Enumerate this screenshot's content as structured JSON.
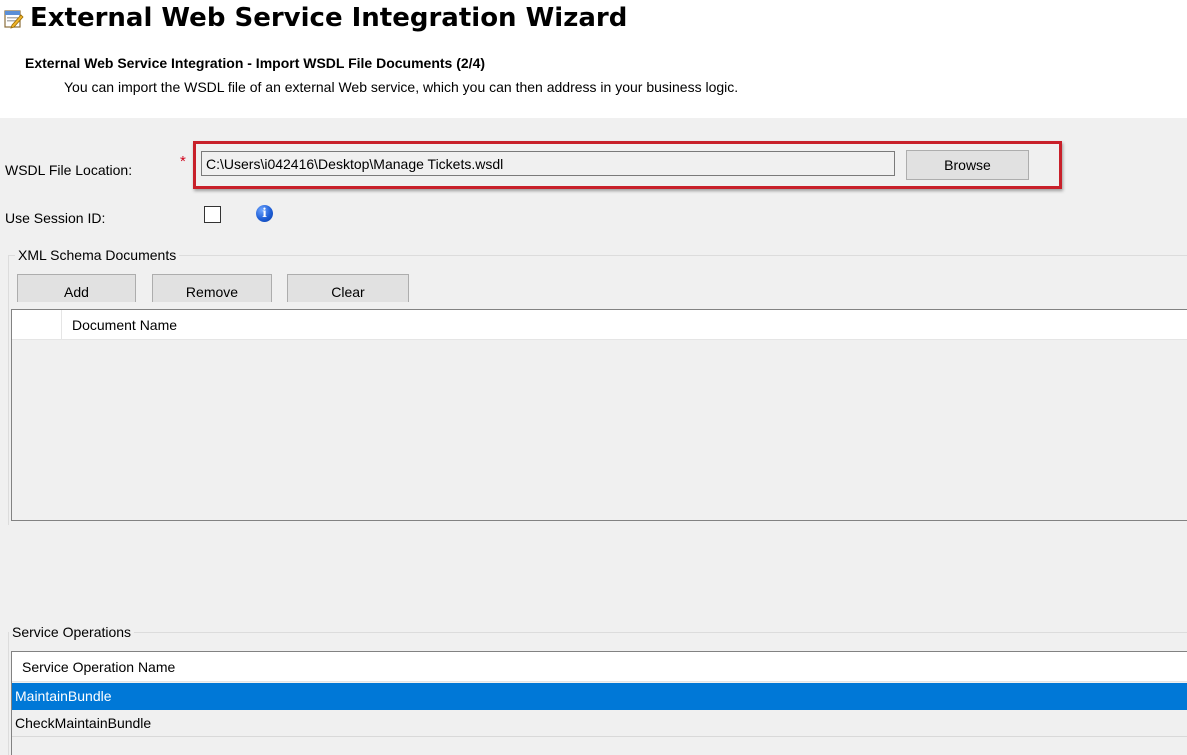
{
  "wizard": {
    "title": "External Web Service Integration Wizard",
    "step_title": "External Web Service Integration - Import WSDL File Documents (2/4)",
    "step_description": "You can import the WSDL file of an external Web service, which you can then address in your business logic."
  },
  "form": {
    "wsdl_label": "WSDL File Location:",
    "required_marker": "*",
    "wsdl_value": "C:\\Users\\i042416\\Desktop\\Manage Tickets.wsdl",
    "browse_label": "Browse",
    "session_label": "Use Session ID:",
    "session_checked": false,
    "info_glyph": "i",
    "highlight_color": "#c8202a"
  },
  "schema": {
    "group_title": "XML Schema Documents",
    "buttons": {
      "add": "Add",
      "remove": "Remove",
      "clear": "Clear"
    },
    "columns": [
      "Document Name"
    ],
    "rows": []
  },
  "operations": {
    "group_title": "Service Operations",
    "column": "Service Operation Name",
    "rows": [
      {
        "name": "MaintainBundle",
        "selected": true
      },
      {
        "name": "CheckMaintainBundle",
        "selected": false
      }
    ],
    "selection_color": "#0078d7"
  },
  "icons": {
    "app": "wizard-app-icon",
    "info": "info-icon"
  }
}
